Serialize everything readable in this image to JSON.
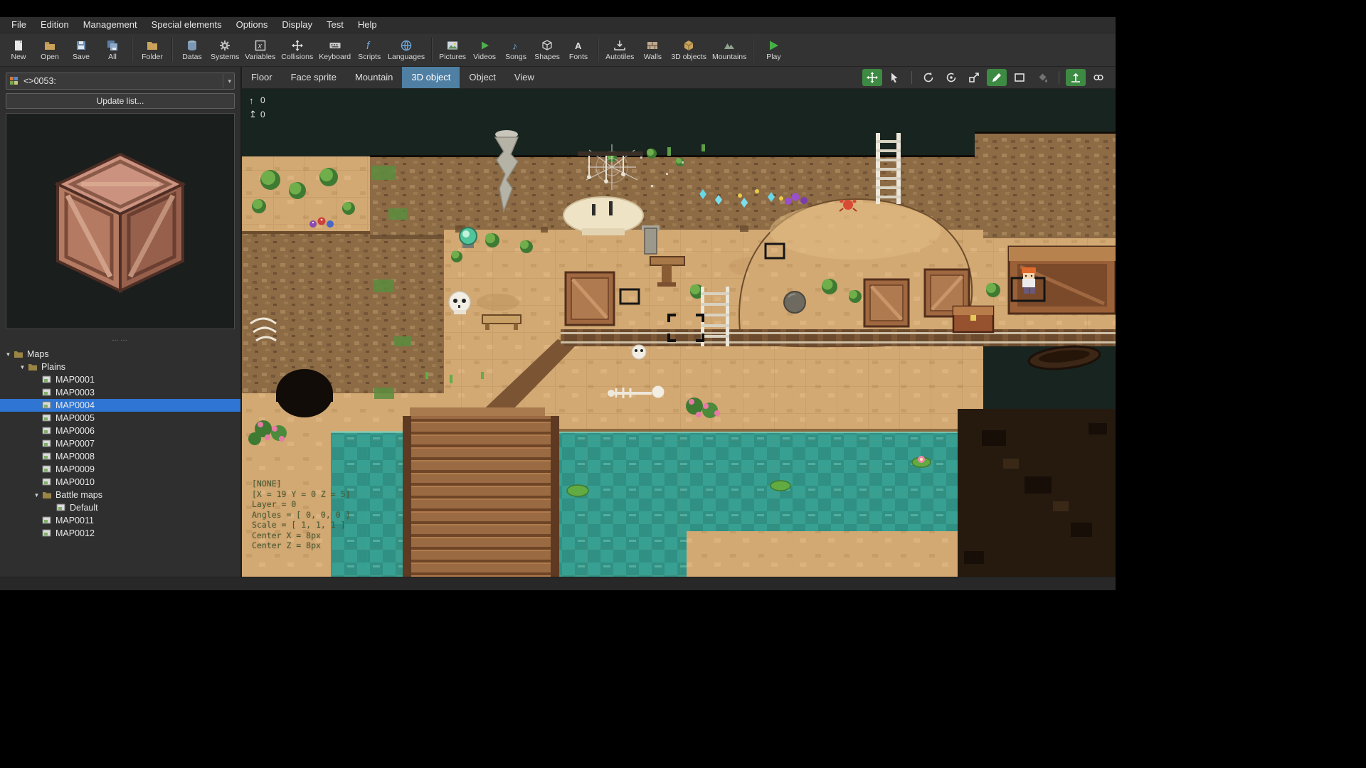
{
  "window": {
    "background": "#000000",
    "app_background": "#2f2f2f"
  },
  "menu_bar": {
    "items": [
      {
        "label": "File"
      },
      {
        "label": "Edition"
      },
      {
        "label": "Management"
      },
      {
        "label": "Special elements"
      },
      {
        "label": "Options"
      },
      {
        "label": "Display"
      },
      {
        "label": "Test"
      },
      {
        "label": "Help"
      }
    ]
  },
  "toolbar": {
    "items": [
      {
        "label": "New",
        "icon": "new-file-icon"
      },
      {
        "label": "Open",
        "icon": "open-folder-icon"
      },
      {
        "label": "Save",
        "icon": "save-icon"
      },
      {
        "label": "All",
        "icon": "save-all-icon"
      },
      {
        "label": "Folder",
        "icon": "folder-icon"
      },
      {
        "label": "Datas",
        "icon": "datas-icon"
      },
      {
        "label": "Systems",
        "icon": "systems-icon"
      },
      {
        "label": "Variables",
        "icon": "variables-icon"
      },
      {
        "label": "Collisions",
        "icon": "collisions-icon"
      },
      {
        "label": "Keyboard",
        "icon": "keyboard-icon"
      },
      {
        "label": "Scripts",
        "icon": "scripts-icon"
      },
      {
        "label": "Languages",
        "icon": "languages-icon"
      },
      {
        "label": "Pictures",
        "icon": "pictures-icon"
      },
      {
        "label": "Videos",
        "icon": "videos-icon"
      },
      {
        "label": "Songs",
        "icon": "songs-icon"
      },
      {
        "label": "Shapes",
        "icon": "shapes-icon"
      },
      {
        "label": "Fonts",
        "icon": "fonts-icon"
      },
      {
        "label": "Autotiles",
        "icon": "autotiles-icon"
      },
      {
        "label": "Walls",
        "icon": "walls-icon"
      },
      {
        "label": "3D objects",
        "icon": "objects-3d-icon"
      },
      {
        "label": "Mountains",
        "icon": "mountains-icon"
      },
      {
        "label": "Play",
        "icon": "play-icon"
      }
    ]
  },
  "left_panel": {
    "texture_select": {
      "value": "<>0053:"
    },
    "update_button": {
      "label": "Update list..."
    },
    "tree": {
      "items": [
        {
          "label": "Maps",
          "depth": 0,
          "type": "folder",
          "expanded": true
        },
        {
          "label": "Plains",
          "depth": 1,
          "type": "folder",
          "expanded": true
        },
        {
          "label": "MAP0001",
          "depth": 2,
          "type": "map"
        },
        {
          "label": "MAP0003",
          "depth": 2,
          "type": "map"
        },
        {
          "label": "MAP0004",
          "depth": 2,
          "type": "map",
          "selected": true
        },
        {
          "label": "MAP0005",
          "depth": 2,
          "type": "map"
        },
        {
          "label": "MAP0006",
          "depth": 2,
          "type": "map"
        },
        {
          "label": "MAP0007",
          "depth": 2,
          "type": "map"
        },
        {
          "label": "MAP0008",
          "depth": 2,
          "type": "map"
        },
        {
          "label": "MAP0009",
          "depth": 2,
          "type": "map"
        },
        {
          "label": "MAP0010",
          "depth": 2,
          "type": "map"
        },
        {
          "label": "Battle maps",
          "depth": 2,
          "type": "folder",
          "expanded": true
        },
        {
          "label": "Default",
          "depth": 3,
          "type": "map"
        },
        {
          "label": "MAP0011",
          "depth": 2,
          "type": "map"
        },
        {
          "label": "MAP0012",
          "depth": 2,
          "type": "map"
        }
      ]
    }
  },
  "editor": {
    "tabs": [
      {
        "label": "Floor"
      },
      {
        "label": "Face sprite"
      },
      {
        "label": "Mountain"
      },
      {
        "label": "3D object",
        "active": true
      },
      {
        "label": "Object"
      },
      {
        "label": "View"
      }
    ],
    "tools": [
      {
        "icon": "translate-icon",
        "active": true
      },
      {
        "icon": "move-cursor-icon"
      },
      {
        "icon": "rotate-icon"
      },
      {
        "icon": "rotate-free-icon"
      },
      {
        "icon": "scale-icon"
      },
      {
        "icon": "pencil-icon",
        "active": true
      },
      {
        "icon": "rectangle-icon"
      },
      {
        "icon": "paint-bucket-icon",
        "disabled": true
      },
      {
        "icon": "height-icon",
        "active": true
      },
      {
        "icon": "link-icon"
      }
    ],
    "height_controls": [
      {
        "icon": "up-arrow-icon",
        "value": "0"
      },
      {
        "icon": "up-arrow-bar-icon",
        "value": "0"
      }
    ],
    "overlay": {
      "lines": [
        "[NONE]",
        "[X = 19 Y = 0 Z = 5]",
        "Layer = 0",
        "Angles = [ 0, 0, 0 ]",
        "Scale = [ 1, 1, 1 ]",
        "Center X = 8px",
        "Center Z = 8px"
      ]
    }
  },
  "colors": {
    "selection_blue": "#2e75d4",
    "active_tab_blue": "#4f7fa3",
    "tool_active_green": "#3d8a43",
    "water_teal": "#37a092",
    "sand": "#d2a873"
  }
}
